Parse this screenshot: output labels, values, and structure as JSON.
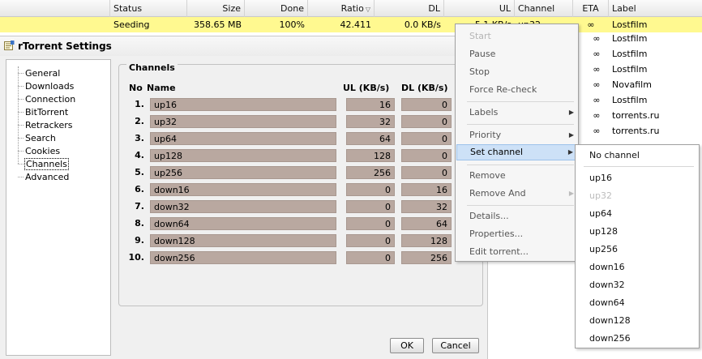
{
  "list": {
    "columns": {
      "status": "Status",
      "size": "Size",
      "done": "Done",
      "ratio": "Ratio",
      "dl": "DL",
      "ul": "UL",
      "channel": "Channel",
      "eta": "ETA",
      "label": "Label"
    },
    "selected_row": {
      "status": "Seeding",
      "size": "358.65 MB",
      "done": "100%",
      "ratio": "42.411",
      "dl": "0.0 KB/s",
      "ul": "5.1 KB/s",
      "channel": "up32",
      "eta": "∞",
      "label": "Lostfilm"
    },
    "rows": [
      {
        "eta": "∞",
        "label": "Lostfilm"
      },
      {
        "eta": "∞",
        "label": "Lostfilm"
      },
      {
        "eta": "∞",
        "label": "Lostfilm"
      },
      {
        "eta": "∞",
        "label": "Novafilm"
      },
      {
        "eta": "∞",
        "label": "Lostfilm"
      },
      {
        "eta": "∞",
        "label": "torrents.ru"
      },
      {
        "eta": "∞",
        "label": "torrents.ru"
      }
    ]
  },
  "settings": {
    "title": "rTorrent Settings",
    "nav": [
      "General",
      "Downloads",
      "Connection",
      "BitTorrent",
      "Retrackers",
      "Search",
      "Cookies",
      "Channels",
      "Advanced"
    ],
    "active_nav": "Channels",
    "channels": {
      "legend": "Channels",
      "headers": {
        "no": "No",
        "name": "Name",
        "ul": "UL (KB/s)",
        "dl": "DL (KB/s)"
      },
      "rows": [
        {
          "no": "1.",
          "name": "up16",
          "ul": "16",
          "dl": "0"
        },
        {
          "no": "2.",
          "name": "up32",
          "ul": "32",
          "dl": "0"
        },
        {
          "no": "3.",
          "name": "up64",
          "ul": "64",
          "dl": "0"
        },
        {
          "no": "4.",
          "name": "up128",
          "ul": "128",
          "dl": "0"
        },
        {
          "no": "5.",
          "name": "up256",
          "ul": "256",
          "dl": "0"
        },
        {
          "no": "6.",
          "name": "down16",
          "ul": "0",
          "dl": "16"
        },
        {
          "no": "7.",
          "name": "down32",
          "ul": "0",
          "dl": "32"
        },
        {
          "no": "8.",
          "name": "down64",
          "ul": "0",
          "dl": "64"
        },
        {
          "no": "9.",
          "name": "down128",
          "ul": "0",
          "dl": "128"
        },
        {
          "no": "10.",
          "name": "down256",
          "ul": "0",
          "dl": "256"
        }
      ]
    },
    "ok_label": "OK",
    "cancel_label": "Cancel"
  },
  "context_menu": {
    "start": "Start",
    "pause": "Pause",
    "stop": "Stop",
    "force_recheck": "Force Re-check",
    "labels": "Labels",
    "priority": "Priority",
    "set_channel": "Set channel",
    "remove": "Remove",
    "remove_and": "Remove And",
    "details": "Details...",
    "properties": "Properties...",
    "edit_torrent": "Edit torrent..."
  },
  "channel_submenu": {
    "no_channel": "No channel",
    "items": [
      "up16",
      "up32",
      "up64",
      "up128",
      "up256",
      "down16",
      "down32",
      "down64",
      "down128",
      "down256"
    ],
    "disabled_item": "up32"
  },
  "colors": {
    "selected_row": "#fff990",
    "channel_field": "#b9a8a0",
    "menu_highlight": "#cde1f7"
  },
  "icons": {
    "settings": "settings-window-icon",
    "sort": "sort-arrow-icon",
    "submenu": "submenu-arrow-icon"
  }
}
